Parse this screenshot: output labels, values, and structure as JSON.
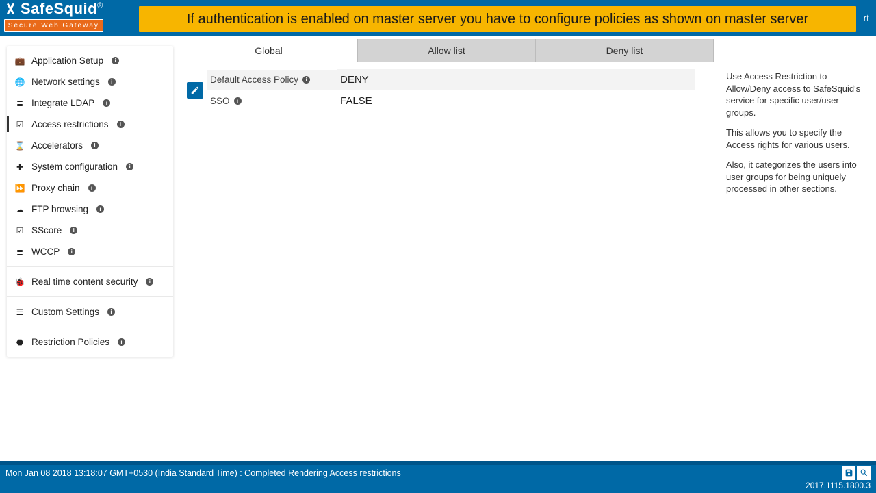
{
  "logo": {
    "name": "SafeSquid",
    "reg": "®",
    "tagline": "Secure Web Gateway"
  },
  "banner": "If authentication is enabled on master server you have to configure policies as shown on master server",
  "topbar": {
    "right_fragment": "rt"
  },
  "sidebar": {
    "groups": [
      {
        "heading": {
          "label": "Application Setup",
          "icon": "briefcase-icon"
        },
        "items": [
          {
            "label": "Network settings",
            "icon": "globe-icon",
            "active": false
          },
          {
            "label": "Integrate LDAP",
            "icon": "list-icon",
            "active": false
          },
          {
            "label": "Access restrictions",
            "icon": "check-square-icon",
            "active": true
          },
          {
            "label": "Accelerators",
            "icon": "gauge-icon",
            "active": false
          },
          {
            "label": "System configuration",
            "icon": "puzzle-icon",
            "active": false
          },
          {
            "label": "Proxy chain",
            "icon": "forward-icon",
            "active": false
          },
          {
            "label": "FTP browsing",
            "icon": "cloud-icon",
            "active": false
          },
          {
            "label": "SScore",
            "icon": "check-square-icon",
            "active": false
          },
          {
            "label": "WCCP",
            "icon": "storage-icon",
            "active": false
          }
        ]
      },
      {
        "heading": {
          "label": "Real time content security",
          "icon": "bug-icon"
        },
        "items": []
      },
      {
        "heading": {
          "label": "Custom Settings",
          "icon": "sliders-icon"
        },
        "items": []
      },
      {
        "heading": {
          "label": "Restriction Policies",
          "icon": "shield-icon"
        },
        "items": []
      }
    ]
  },
  "tabs": [
    {
      "label": "Global",
      "active": true
    },
    {
      "label": "Allow list",
      "active": false
    },
    {
      "label": "Deny list",
      "active": false
    }
  ],
  "settings": {
    "rows": [
      {
        "label": "Default Access Policy",
        "value": "DENY"
      },
      {
        "label": "SSO",
        "value": "FALSE"
      }
    ]
  },
  "info": {
    "p1": "Use Access Restriction to Allow/Deny access to SafeSquid's service for specific user/user groups.",
    "p2": "This allows you to specify the Access rights for various users.",
    "p3": "Also, it categorizes the users into user groups for being uniquely processed in other sections."
  },
  "footer": {
    "status": "Mon Jan 08 2018 13:18:07 GMT+0530 (India Standard Time) : Completed Rendering Access restrictions",
    "version": "2017.1115.1800.3"
  }
}
